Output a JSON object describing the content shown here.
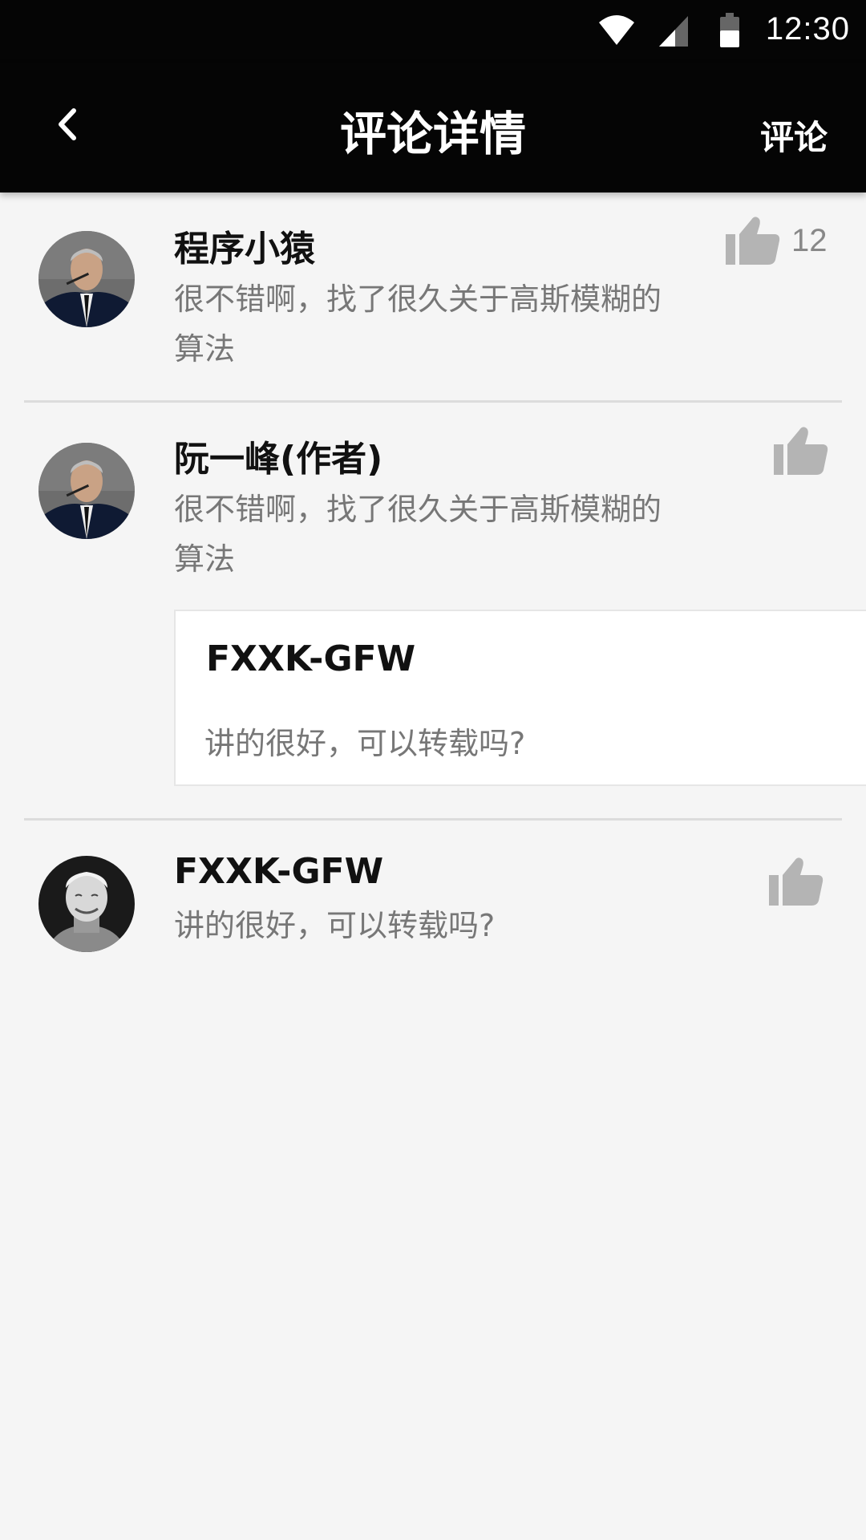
{
  "status_bar": {
    "time": "12:30",
    "icons": [
      "wifi-icon",
      "signal-icon",
      "battery-icon"
    ]
  },
  "app_bar": {
    "back_icon": "chevron-left-icon",
    "title": "评论详情",
    "action_label": "评论"
  },
  "comments": [
    {
      "username": "程序小猿",
      "text": "很不错啊，找了很久关于高斯模糊的算法",
      "likes": "12",
      "avatar": "avatar-man-suit"
    },
    {
      "username": "阮一峰(作者)",
      "text": "很不错啊，找了很久关于高斯模糊的算法",
      "avatar": "avatar-man-suit",
      "reply": {
        "username": "FXXK-GFW",
        "text": "讲的很好，可以转载吗?"
      }
    },
    {
      "username": "FXXK-GFW",
      "text": "讲的很好，可以转载吗?",
      "avatar": "avatar-man-smiling"
    }
  ],
  "colors": {
    "bar_bg": "#050505",
    "page_bg": "#f5f5f5",
    "like_icon": "#b4b4b4",
    "secondary_text": "#777777"
  }
}
